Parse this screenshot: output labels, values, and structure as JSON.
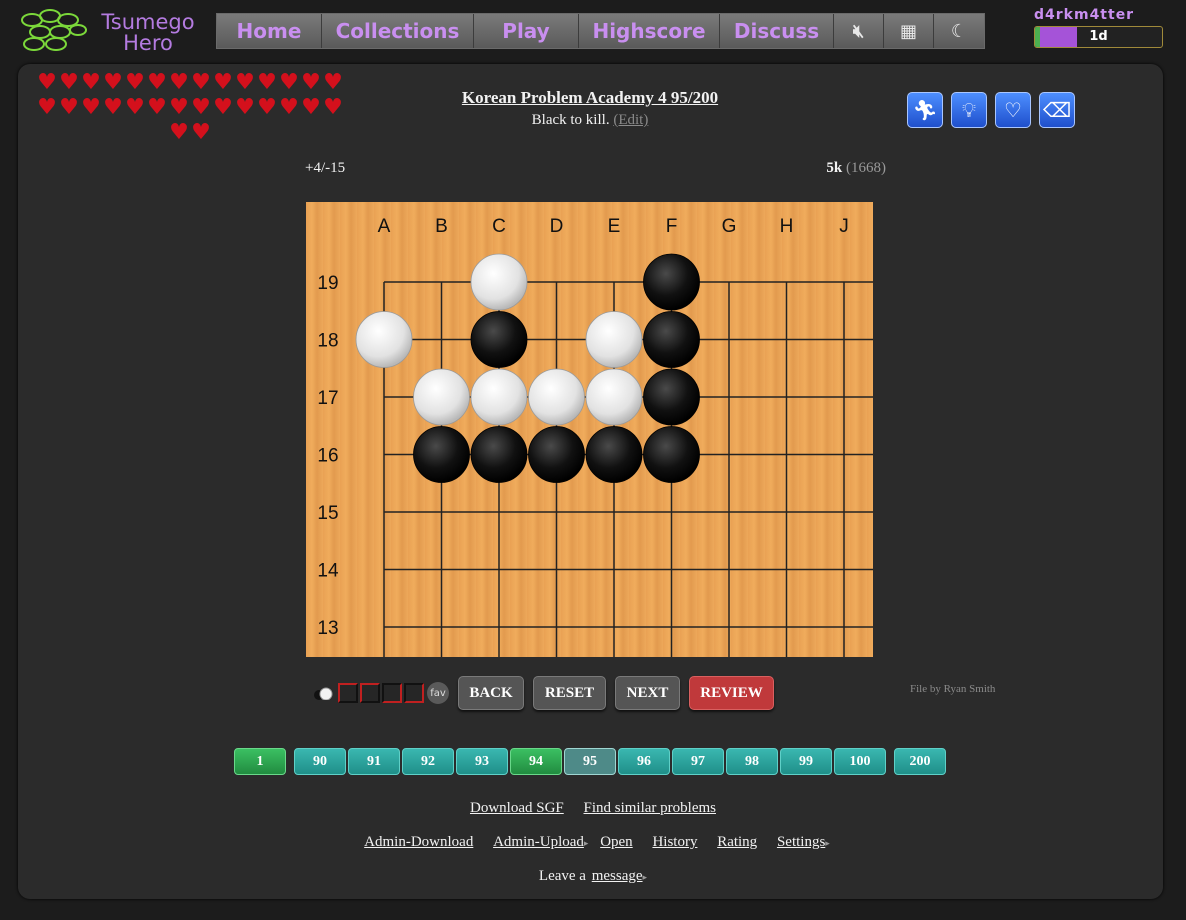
{
  "header": {
    "logo_text_line1": "Tsumego",
    "logo_text_line2": "Hero",
    "nav": [
      "Home",
      "Collections",
      "Play",
      "Highscore",
      "Discuss"
    ],
    "icons": [
      "mute-icon",
      "grid-icon",
      "moon-icon"
    ],
    "user": {
      "name": "d4rkm4tter",
      "rank": "1d",
      "rank_progress": 0.33
    }
  },
  "hearts": {
    "count": 30,
    "symbol": "♥",
    "color": "#d4101c"
  },
  "problem": {
    "title": "Korean Problem Academy 4 95/200",
    "description": "Black to kill.",
    "edit": "(Edit)"
  },
  "actions": [
    "sprint-icon",
    "hint-icon",
    "heart-icon",
    "eraser-icon"
  ],
  "stats": {
    "score": "+4/-15",
    "rank": "5k",
    "rating": "(1668)"
  },
  "board": {
    "columns": [
      "A",
      "B",
      "C",
      "D",
      "E",
      "F",
      "G",
      "H",
      "J"
    ],
    "rows": [
      "19",
      "18",
      "17",
      "16",
      "15",
      "14",
      "13"
    ],
    "white_stones": [
      "C19",
      "A18",
      "E18",
      "B17",
      "C17",
      "D17",
      "E17"
    ],
    "black_stones": [
      "F19",
      "C18",
      "F18",
      "F17",
      "B16",
      "C16",
      "D16",
      "E16",
      "F16"
    ]
  },
  "controls": {
    "fav": "fav",
    "back": "BACK",
    "reset": "RESET",
    "next": "NEXT",
    "review": "REVIEW",
    "file_by": "File by Ryan Smith"
  },
  "pages": [
    {
      "label": "1",
      "style": "green"
    },
    {
      "label": "90",
      "style": "teal"
    },
    {
      "label": "91",
      "style": "teal"
    },
    {
      "label": "92",
      "style": "teal"
    },
    {
      "label": "93",
      "style": "teal"
    },
    {
      "label": "94",
      "style": "green"
    },
    {
      "label": "95",
      "style": "current"
    },
    {
      "label": "96",
      "style": "teal"
    },
    {
      "label": "97",
      "style": "teal"
    },
    {
      "label": "98",
      "style": "teal"
    },
    {
      "label": "99",
      "style": "teal"
    },
    {
      "label": "100",
      "style": "teal"
    },
    {
      "label": "200",
      "style": "teal"
    }
  ],
  "links": {
    "download_sgf": "Download SGF",
    "find_similar": "Find similar problems",
    "admin_download": "Admin-Download",
    "admin_upload": "Admin-Upload",
    "open": "Open",
    "history": "History",
    "rating": "Rating",
    "settings": "Settings",
    "leave_a": "Leave a",
    "message": "message"
  }
}
